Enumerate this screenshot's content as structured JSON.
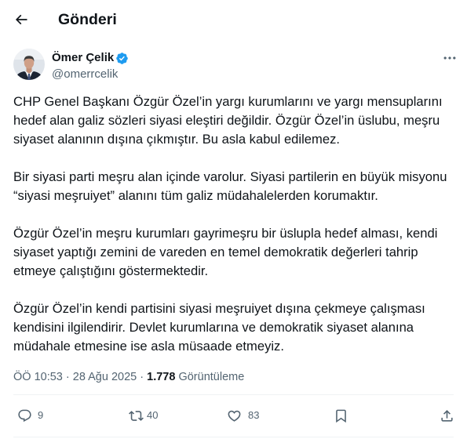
{
  "header": {
    "title": "Gönderi",
    "back_icon": "arrow-left-icon"
  },
  "author": {
    "name": "Ömer Çelik",
    "handle": "@omerrcelik",
    "verified": true,
    "verified_icon": "verified-badge-icon"
  },
  "more_icon": "more-horizontal-icon",
  "post": {
    "paragraphs": [
      {
        "lines": [
          "CHP Genel Başkanı Özgür Özel’in yargı kurumlarını ve yargı mensuplarını",
          "hedef alan galiz sözleri siyasi eleştiri değildir. Özgür Özel’in üslubu, meşru",
          "siyaset alanının dışına çıkmıştır. Bu asla kabul edilemez."
        ]
      },
      {
        "lines": [
          "Bir siyasi parti meşru alan içinde varolur. Siyasi partilerin en büyük misyonu",
          "“siyasi meşruiyet” alanını tüm galiz müdahalelerden korumaktır."
        ]
      },
      {
        "lines": [
          "Özgür Özel’in meşru kurumları gayrimeşru bir üslupla hedef alması, kendi",
          "siyaset yaptığı zemini de vareden en temel demokratik değerleri tahrip",
          "etmeye çalıştığını göstermektedir."
        ]
      },
      {
        "lines": [
          "Özgür Özel’in kendi partisini siyasi meşruiyet dışına çekmeye çalışması",
          "kendisini ilgilendirir. Devlet kurumlarına ve demokratik siyaset alanına",
          "müdahale etmesine ise asla müsaade etmeyiz."
        ]
      }
    ]
  },
  "meta": {
    "time": "ÖÖ 10:53",
    "separator": "·",
    "date": "28 Ağu 2025",
    "views_count": "1.778",
    "views_label": "Görüntüleme"
  },
  "actions": {
    "reply": {
      "icon": "reply-icon",
      "count": "9"
    },
    "repost": {
      "icon": "repost-icon",
      "count": "40"
    },
    "like": {
      "icon": "heart-icon",
      "count": "83"
    },
    "bookmark": {
      "icon": "bookmark-icon"
    },
    "share": {
      "icon": "share-icon"
    }
  },
  "colors": {
    "text": "#0f1419",
    "secondary": "#536471",
    "divider": "#eff3f4",
    "accent": "#1d9bf0"
  }
}
